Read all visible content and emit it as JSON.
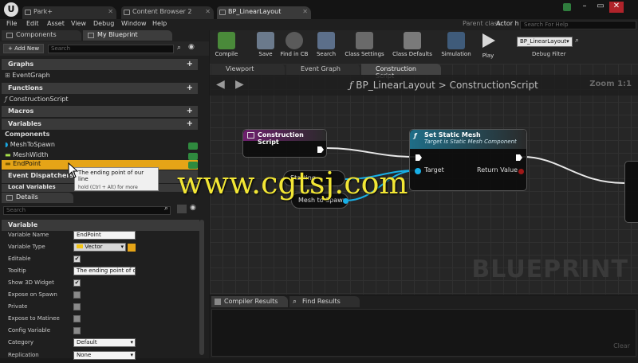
{
  "titlebar": {
    "tabs": [
      "Park+",
      "Content Browser 2",
      "BP_LinearLayout"
    ],
    "logo": "U"
  },
  "menu": {
    "items": [
      "File",
      "Edit",
      "Asset",
      "View",
      "Debug",
      "Window",
      "Help"
    ],
    "parent_class_label": "Parent class:",
    "parent_class_value": "Actor h",
    "search_help_placeholder": "Search For Help"
  },
  "left_panel": {
    "tabs": [
      "Components",
      "My Blueprint"
    ],
    "add_new_label": "+ Add New",
    "search_placeholder": "Search",
    "sections": {
      "graphs": "Graphs",
      "event_graph": "EventGraph",
      "functions": "Functions",
      "construction_script": "ConstructionScript",
      "macros": "Macros",
      "variables": "Variables",
      "components": "Components",
      "var_mesh_to_spawn": "MeshToSpawn",
      "var_mesh_width": "MeshWidth",
      "var_end_point": "EndPoint",
      "event_dispatchers": "Event Dispatchers",
      "local_variables": "Local Variables"
    },
    "tooltip": {
      "title": "The ending point of our line",
      "hint": "hold (Ctrl + Alt) for more"
    },
    "details": {
      "tab": "Details",
      "search_placeholder": "Search",
      "section": "Variable",
      "rows": [
        {
          "label": "Variable Name",
          "value": "EndPoint"
        },
        {
          "label": "Variable Type",
          "value": "Vector"
        },
        {
          "label": "Editable",
          "value": "✔"
        },
        {
          "label": "Tooltip",
          "value": "The ending point of our"
        },
        {
          "label": "Show 3D Widget",
          "value": "✔"
        },
        {
          "label": "Expose on Spawn",
          "value": ""
        },
        {
          "label": "Private",
          "value": ""
        },
        {
          "label": "Expose to Matinee",
          "value": ""
        },
        {
          "label": "Config Variable",
          "value": ""
        },
        {
          "label": "Category",
          "value": "Default"
        },
        {
          "label": "Replication",
          "value": "None"
        }
      ]
    }
  },
  "toolbar": {
    "buttons": [
      "Compile",
      "Save",
      "Find in CB",
      "Search",
      "Class Settings",
      "Class Defaults",
      "Simulation",
      "Play"
    ],
    "debug_object": "BP_LinearLayout▾",
    "debug_filter_label": "Debug Filter"
  },
  "graph": {
    "tabs": [
      "Viewport",
      "Event Graph",
      "Construction Script"
    ],
    "breadcrumb_bp": "BP_LinearLayout",
    "breadcrumb_sep": ">",
    "breadcrumb_fn": "ConstructionScript",
    "zoom": "Zoom 1:1",
    "nodes": {
      "construction": "Construction Script",
      "set_mesh_title": "Set Static Mesh",
      "set_mesh_sub": "Target is Static Mesh Component",
      "target_pin": "Target",
      "return_pin": "Return Value",
      "starting_var": "Starting",
      "mesh_spawn_var": "Mesh to Spawn"
    },
    "watermark": "BLUEPRINT"
  },
  "bottom": {
    "tabs": [
      "Compiler Results",
      "Find Results"
    ],
    "clear_label": "Clear"
  },
  "overlay_watermark": "www.cgtsj.com",
  "colors": {
    "accent_selected": "#e5a417",
    "function_header": "#1f6e88",
    "event_header": "#6e1f6e",
    "vector_pin": "#f3c516",
    "object_pin": "#18b0e8"
  }
}
